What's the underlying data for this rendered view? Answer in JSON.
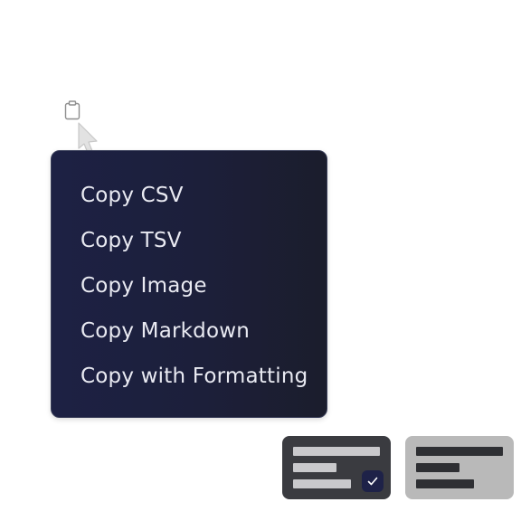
{
  "context_menu": {
    "items": [
      {
        "label": "Copy CSV"
      },
      {
        "label": "Copy TSV"
      },
      {
        "label": "Copy Image"
      },
      {
        "label": "Copy Markdown"
      },
      {
        "label": "Copy with Formatting"
      }
    ]
  },
  "icons": {
    "clipboard": "clipboard-icon",
    "cursor": "pointer-cursor-icon",
    "check": "check-icon"
  },
  "theme_options": {
    "items": [
      {
        "theme": "dark",
        "selected": true
      },
      {
        "theme": "light",
        "selected": false
      }
    ]
  },
  "colors": {
    "menu_background": "#1d2144",
    "menu_text": "#e9eaf2",
    "dark_thumb": "#3a3b40",
    "light_thumb": "#b9b9b9",
    "accent": "#1e2248"
  }
}
